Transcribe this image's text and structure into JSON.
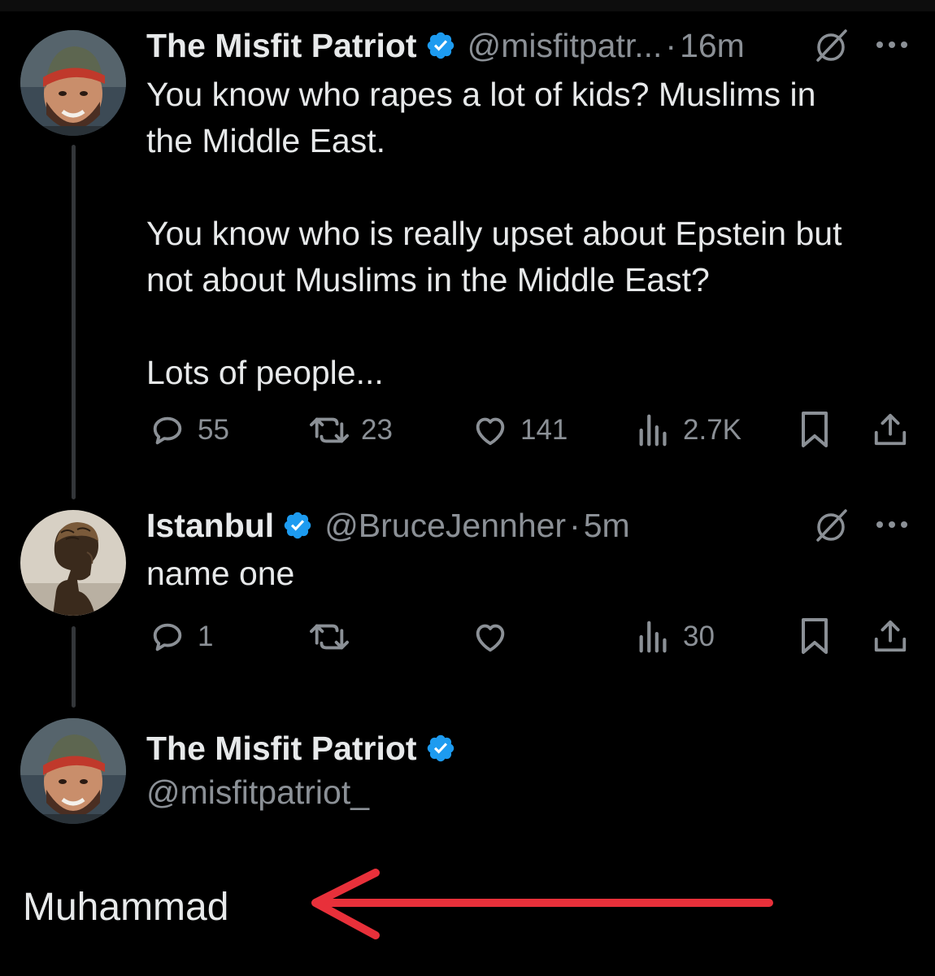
{
  "tweet1": {
    "name": "The Misfit Patriot",
    "handle": "@misfitpatr...",
    "separator": "·",
    "time": "16m",
    "text": "You know who rapes a lot of kids? Muslims in\nthe Middle East.\n\nYou know who is really upset about Epstein but\nnot about Muslims in the Middle East?\n\nLots of people...",
    "replies": "55",
    "reposts": "23",
    "likes": "141",
    "views": "2.7K"
  },
  "tweet2": {
    "name": "Istanbul",
    "handle": "@BruceJennher",
    "separator": "·",
    "time": "5m",
    "text": "name one",
    "replies": "1",
    "views": "30"
  },
  "reply": {
    "name": "The Misfit Patriot",
    "handle": "@misfitpatriot_",
    "text": "Muhammad"
  },
  "colors": {
    "background": "#000000",
    "text": "#e7e9ea",
    "muted": "#8b9096",
    "verified": "#1d9bf0",
    "arrow": "#e8303a",
    "thread_line": "#333639"
  },
  "icons": {
    "verified": "verified-badge-icon",
    "grok": "slashed-circle-icon",
    "more": "more-dots-icon",
    "reply": "reply-bubble-icon",
    "repost": "repost-icon",
    "like": "heart-icon",
    "views": "views-bars-icon",
    "bookmark": "bookmark-icon",
    "share": "share-icon",
    "arrow": "red-arrow-icon"
  }
}
